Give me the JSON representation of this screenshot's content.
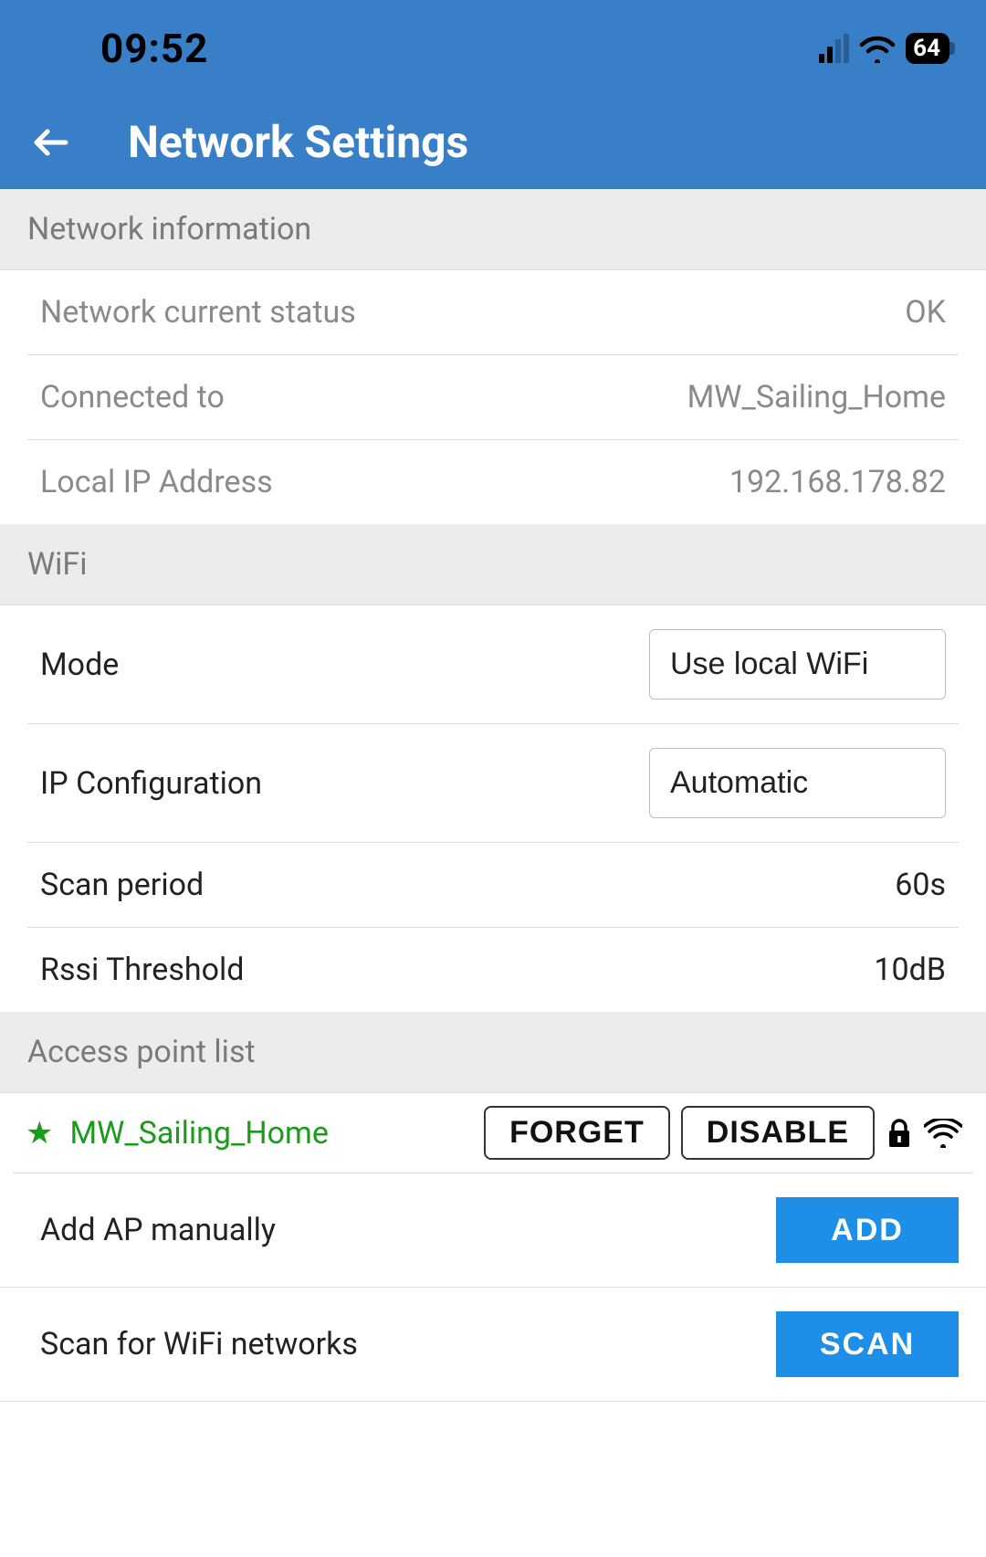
{
  "status": {
    "time": "09:52",
    "battery": "64"
  },
  "header": {
    "title": "Network Settings"
  },
  "sections": {
    "info": {
      "title": "Network information",
      "rows": {
        "status_label": "Network current status",
        "status_value": "OK",
        "connected_label": "Connected to",
        "connected_value": "MW_Sailing_Home",
        "ip_label": "Local IP Address",
        "ip_value": "192.168.178.82"
      }
    },
    "wifi": {
      "title": "WiFi",
      "rows": {
        "mode_label": "Mode",
        "mode_value": "Use local WiFi",
        "ipconf_label": "IP Configuration",
        "ipconf_value": "Automatic",
        "scan_label": "Scan period",
        "scan_value": "60s",
        "rssi_label": "Rssi Threshold",
        "rssi_value": "10dB"
      }
    },
    "ap": {
      "title": "Access point list",
      "current": {
        "name": "MW_Sailing_Home",
        "forget": "FORGET",
        "disable": "DISABLE"
      },
      "add": {
        "label": "Add AP manually",
        "button": "ADD"
      },
      "scan": {
        "label": "Scan for WiFi networks",
        "button": "SCAN"
      }
    }
  }
}
